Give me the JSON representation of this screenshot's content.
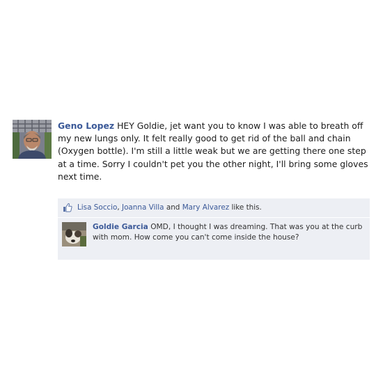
{
  "post": {
    "author": "Geno Lopez",
    "text": "HEY Goldie, jet want you to know I was able to breath off my new lungs only. It felt really good to get rid of the ball and chain (Oxygen bottle). I'm still a little weak but we are getting there one step at a time. Sorry I couldn't pet you the other night, I'll bring some gloves next time."
  },
  "likes": {
    "user1": "Lisa Soccio",
    "sep1": ", ",
    "user2": "Joanna Villa",
    "sep2": " and ",
    "user3": "Mary Alvarez",
    "suffix": " like this."
  },
  "comment": {
    "author": "Goldie Garcia",
    "text": "OMD, I thought I was dreaming. That was you at the curb with mom. How come you can't come inside the house?"
  },
  "colors": {
    "link": "#3b5998",
    "feedback_bg": "#edeff4",
    "text": "#1c1c1c"
  },
  "icons": {
    "like": "thumbs-up-icon"
  }
}
